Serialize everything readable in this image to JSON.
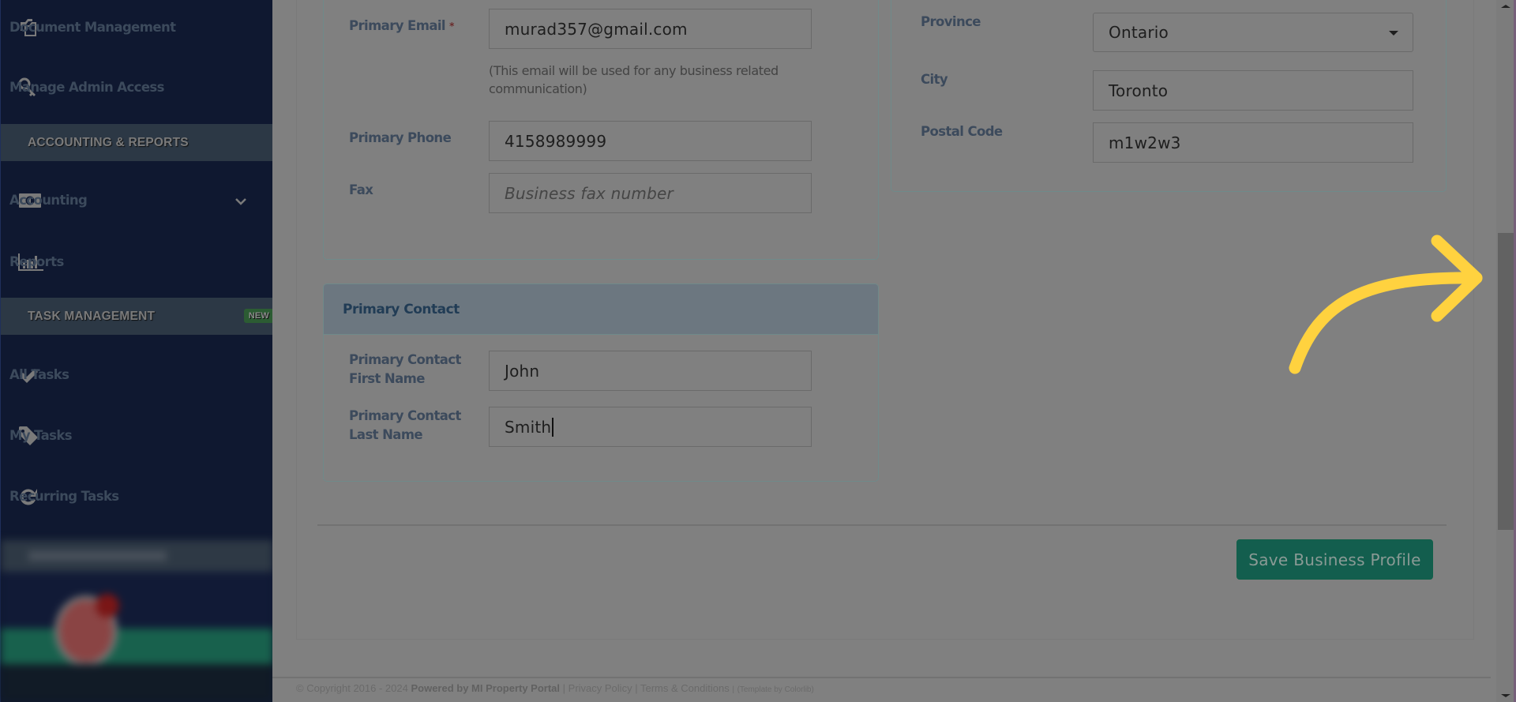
{
  "sidebar": {
    "items": [
      {
        "label": "Document Management",
        "icon": "documents-icon"
      },
      {
        "label": "Manage Admin Access",
        "icon": "key-icon"
      },
      {
        "label": "Accounting",
        "icon": "money-icon",
        "has_submenu": true
      },
      {
        "label": "Reports",
        "icon": "bar-chart-icon"
      },
      {
        "label": "All Tasks",
        "icon": "check-icon"
      },
      {
        "label": "My Tasks",
        "icon": "tag-icon"
      },
      {
        "label": "Recurring Tasks",
        "icon": "refresh-icon"
      }
    ],
    "sections": [
      {
        "label": "ACCOUNTING & REPORTS"
      },
      {
        "label": "TASK MANAGEMENT",
        "badge": "NEW"
      }
    ]
  },
  "form": {
    "primary_email": {
      "label": "Primary Email",
      "required_mark": "*",
      "value": "murad357@gmail.com",
      "help": "(This email will be used for any business related communication)"
    },
    "primary_phone": {
      "label": "Primary Phone",
      "value": "4158989999"
    },
    "fax": {
      "label": "Fax",
      "placeholder": "Business fax number"
    },
    "province": {
      "label": "Province",
      "value": "Ontario"
    },
    "city": {
      "label": "City",
      "value": "Toronto"
    },
    "postal_code": {
      "label": "Postal Code",
      "value": "m1w2w3"
    },
    "primary_contact": {
      "title": "Primary Contact",
      "first_name": {
        "label": "Primary Contact First Name",
        "value": "John"
      },
      "last_name": {
        "label": "Primary Contact Last Name",
        "value": "Smith"
      }
    },
    "save_label": "Save Business Profile"
  },
  "footer": {
    "copyright": "© Copyright 2016 - 2024",
    "powered_by": "Powered by MI Property Portal",
    "sep": "|",
    "privacy": "Privacy Policy",
    "terms": "Terms & Conditions",
    "template": "(Template by Colorlib)"
  },
  "colors": {
    "sidebar_bg": "#0f1830",
    "section_bg": "#2c3845",
    "badge_new": "#2c5c33",
    "save_button": "#135e4e",
    "arrow": "#ffd23f",
    "overlay": "#808080"
  }
}
